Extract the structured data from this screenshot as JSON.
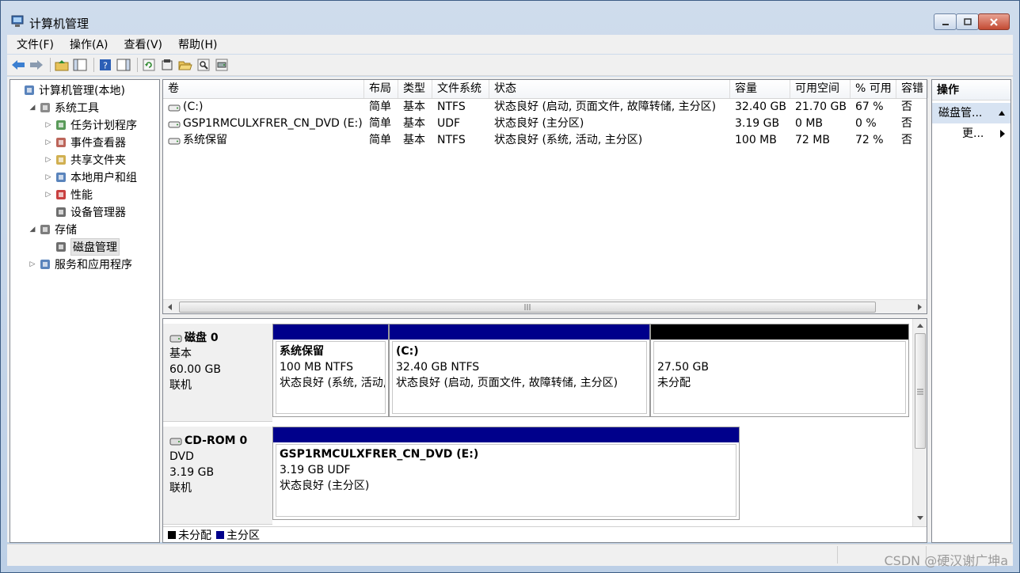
{
  "window": {
    "title": "计算机管理"
  },
  "menu": [
    "文件(F)",
    "操作(A)",
    "查看(V)",
    "帮助(H)"
  ],
  "tree": [
    {
      "label": "计算机管理(本地)",
      "name": "tree-root",
      "arrow": "",
      "icon": "computer-icon"
    },
    {
      "label": "系统工具",
      "name": "tree-system-tools",
      "arrow": "◢",
      "icon": "tools-icon"
    },
    {
      "label": "任务计划程序",
      "name": "tree-task-scheduler",
      "arrow": "▷",
      "icon": "clock-icon"
    },
    {
      "label": "事件查看器",
      "name": "tree-event-viewer",
      "arrow": "▷",
      "icon": "event-icon"
    },
    {
      "label": "共享文件夹",
      "name": "tree-shared-folders",
      "arrow": "▷",
      "icon": "folder-icon"
    },
    {
      "label": "本地用户和组",
      "name": "tree-local-users",
      "arrow": "▷",
      "icon": "users-icon"
    },
    {
      "label": "性能",
      "name": "tree-performance",
      "arrow": "▷",
      "icon": "performance-icon"
    },
    {
      "label": "设备管理器",
      "name": "tree-device-manager",
      "arrow": "",
      "icon": "device-icon"
    },
    {
      "label": "存储",
      "name": "tree-storage",
      "arrow": "◢",
      "icon": "storage-icon"
    },
    {
      "label": "磁盘管理",
      "name": "tree-disk-management",
      "arrow": "",
      "icon": "disk-icon"
    },
    {
      "label": "服务和应用程序",
      "name": "tree-services",
      "arrow": "▷",
      "icon": "services-icon"
    }
  ],
  "volume_columns": [
    "卷",
    "布局",
    "类型",
    "文件系统",
    "状态",
    "容量",
    "可用空间",
    "% 可用",
    "容错"
  ],
  "volumes": [
    [
      "(C:)",
      "简单",
      "基本",
      "NTFS",
      "状态良好 (启动, 页面文件, 故障转储, 主分区)",
      "32.40 GB",
      "21.70 GB",
      "67 %",
      "否"
    ],
    [
      "GSP1RMCULXFRER_CN_DVD (E:)",
      "简单",
      "基本",
      "UDF",
      "状态良好 (主分区)",
      "3.19 GB",
      "0 MB",
      "0 %",
      "否"
    ],
    [
      "系统保留",
      "简单",
      "基本",
      "NTFS",
      "状态良好 (系统, 活动, 主分区)",
      "100 MB",
      "72 MB",
      "72 %",
      "否"
    ]
  ],
  "disks": [
    {
      "name": "磁盘 0",
      "type": "基本",
      "size": "60.00 GB",
      "status": "联机",
      "partitions": [
        {
          "title": "系统保留",
          "line1": "100 MB NTFS",
          "line2": "状态良好 (系统, 活动, 主分区)",
          "kind": "primary"
        },
        {
          "title": "(C:)",
          "line1": "32.40 GB NTFS",
          "line2": "状态良好 (启动, 页面文件, 故障转储, 主分区)",
          "kind": "primary"
        },
        {
          "title": "",
          "line1": "27.50 GB",
          "line2": "未分配",
          "kind": "unallocated"
        }
      ]
    },
    {
      "name": "CD-ROM 0",
      "type": "DVD",
      "size": "3.19 GB",
      "status": "联机",
      "partitions": [
        {
          "title": "GSP1RMCULXFRER_CN_DVD  (E:)",
          "line1": "3.19 GB UDF",
          "line2": "状态良好 (主分区)",
          "kind": "primary"
        }
      ]
    }
  ],
  "legend": [
    {
      "label": "未分配",
      "color": "#000000"
    },
    {
      "label": "主分区",
      "color": "#00008b"
    }
  ],
  "actions": {
    "title": "操作",
    "section": "磁盘管...",
    "more": "更..."
  },
  "watermark": "CSDN @硬汉谢广坤a"
}
